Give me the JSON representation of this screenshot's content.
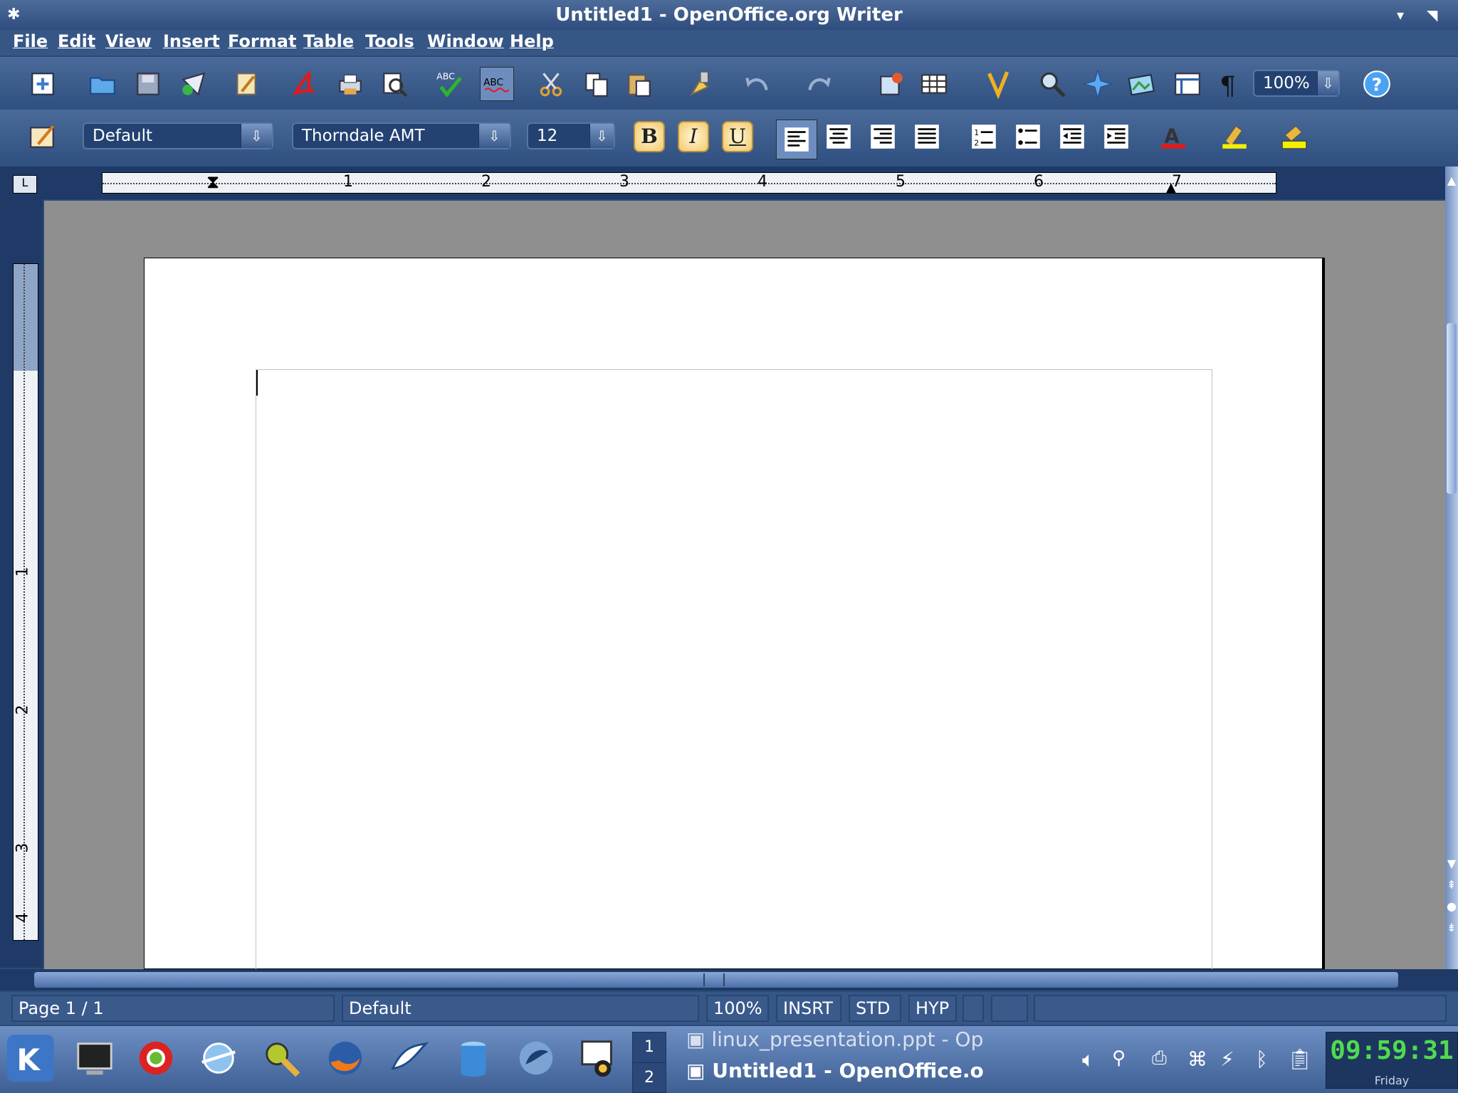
{
  "window": {
    "title": "Untitled1 - OpenOffice.org Writer"
  },
  "menu": [
    "File",
    "Edit",
    "View",
    "Insert",
    "Format",
    "Table",
    "Tools",
    "Window",
    "Help"
  ],
  "toolbar": {
    "zoom": "100%",
    "icons": [
      "new-document-icon",
      "open-folder-icon",
      "save-icon",
      "email-icon",
      "edit-file-icon",
      "export-pdf-icon",
      "print-icon",
      "page-preview-icon",
      "spellcheck-icon",
      "autospellcheck-icon",
      "cut-icon",
      "copy-icon",
      "paste-icon",
      "clone-formatting-icon",
      "undo-icon",
      "redo-icon",
      "hyperlink-icon",
      "insert-table-icon",
      "show-draw-functions-icon",
      "find-replace-icon",
      "navigator-icon",
      "gallery-icon",
      "data-sources-icon",
      "formatting-marks-icon",
      "help-icon"
    ]
  },
  "format": {
    "style": "Default",
    "font": "Thorndale AMT",
    "size": "12",
    "bold": "B",
    "italic": "I",
    "underline": "U"
  },
  "ruler": {
    "h_numbers": [
      "1",
      "2",
      "3",
      "4",
      "5",
      "6",
      "7"
    ],
    "v_numbers": [
      "1",
      "2",
      "3",
      "4"
    ],
    "corner": "L"
  },
  "status": {
    "page": "Page 1 / 1",
    "style": "Default",
    "zoom": "100%",
    "insert_mode": "INSRT",
    "selection_mode": "STD",
    "hyperlink_mode": "HYP"
  },
  "taskbar": {
    "pager": [
      "1",
      "2"
    ],
    "tasks": [
      "linux_presentation.ppt - Op",
      "Untitled1 - OpenOffice.o"
    ],
    "clock": "09:59:31",
    "day": "Friday"
  },
  "colors": {
    "accent": "#365686",
    "title_gradient_top": "#4d6c9a",
    "clock_text": "#4fdb4f"
  }
}
